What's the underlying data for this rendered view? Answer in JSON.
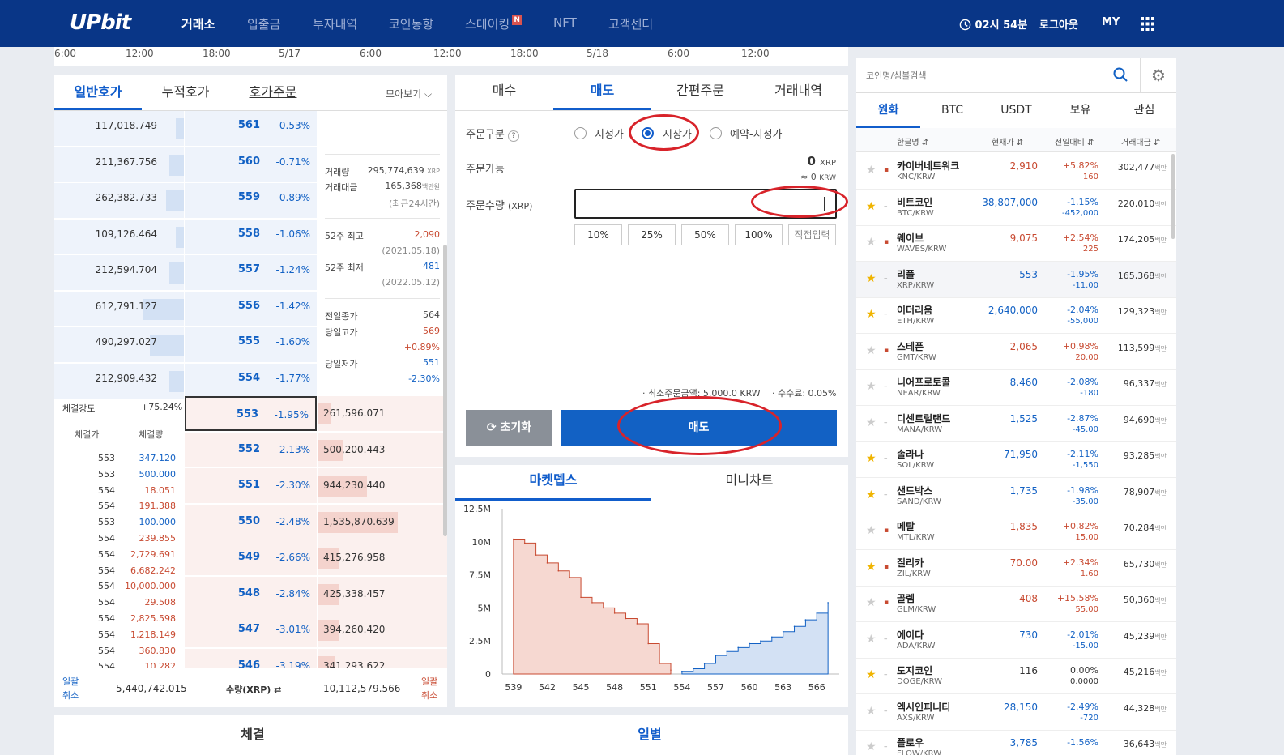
{
  "header": {
    "logo": "UPbit",
    "nav": [
      "거래소",
      "입출금",
      "투자내역",
      "코인동향",
      "스테이킹",
      "NFT",
      "고객센터"
    ],
    "staking_badge": "N",
    "time": "02시 54분",
    "logout": "로그아웃",
    "my": "MY"
  },
  "timeline": {
    "ticks": [
      "6:00",
      "12:00",
      "18:00",
      "5/17",
      "6:00",
      "12:00",
      "18:00",
      "5/18",
      "6:00",
      "12:00"
    ]
  },
  "orderbook": {
    "tabs": [
      "일반호가",
      "누적호가",
      "호가주문"
    ],
    "view": "모아보기",
    "asks": [
      {
        "vol": "117,018.749",
        "price": "561",
        "chg": "-0.53%",
        "bar": 0.06
      },
      {
        "vol": "211,367.756",
        "price": "560",
        "chg": "-0.71%",
        "bar": 0.11
      },
      {
        "vol": "262,382.733",
        "price": "559",
        "chg": "-0.89%",
        "bar": 0.14
      },
      {
        "vol": "109,126.464",
        "price": "558",
        "chg": "-1.06%",
        "bar": 0.06
      },
      {
        "vol": "212,594.704",
        "price": "557",
        "chg": "-1.24%",
        "bar": 0.11
      },
      {
        "vol": "612,791.127",
        "price": "556",
        "chg": "-1.42%",
        "bar": 0.32
      },
      {
        "vol": "490,297.027",
        "price": "555",
        "chg": "-1.60%",
        "bar": 0.26
      },
      {
        "vol": "212,909.432",
        "price": "554",
        "chg": "-1.77%",
        "bar": 0.11
      }
    ],
    "bids": [
      {
        "price": "553",
        "chg": "-1.95%",
        "vol": "261,596.071",
        "bar": 0.14
      },
      {
        "price": "552",
        "chg": "-2.13%",
        "vol": "500,200.443",
        "bar": 0.26
      },
      {
        "price": "551",
        "chg": "-2.30%",
        "vol": "944,230.440",
        "bar": 0.49
      },
      {
        "price": "550",
        "chg": "-2.48%",
        "vol": "1,535,870.639",
        "bar": 0.8
      },
      {
        "price": "549",
        "chg": "-2.66%",
        "vol": "415,276.958",
        "bar": 0.22
      },
      {
        "price": "548",
        "chg": "-2.84%",
        "vol": "425,338.457",
        "bar": 0.22
      },
      {
        "price": "547",
        "chg": "-3.01%",
        "vol": "394,260.420",
        "bar": 0.21
      },
      {
        "price": "546",
        "chg": "-3.19%",
        "vol": "341,293.622",
        "bar": 0.18
      }
    ],
    "stats": {
      "vol_label": "거래량",
      "vol_val": "295,774,639",
      "vol_unit": "XRP",
      "amt_label": "거래대금",
      "amt_val": "165,368",
      "amt_unit": "백만원",
      "period": "(최근24시간)",
      "hi52_label": "52주 최고",
      "hi52": "2,090",
      "hi52_date": "(2021.05.18)",
      "lo52_label": "52주 최저",
      "lo52": "481",
      "lo52_date": "(2022.05.12)",
      "prev_label": "전일종가",
      "prev": "564",
      "high_label": "당일고가",
      "high": "569",
      "high_pct": "+0.89%",
      "low_label": "당일저가",
      "low": "551",
      "low_pct": "-2.30%"
    },
    "strength_label": "체결강도",
    "strength": "+75.24%",
    "trade_hdr": [
      "체결가",
      "체결량"
    ],
    "trades": [
      [
        "553",
        "347.120",
        "b"
      ],
      [
        "553",
        "500.000",
        "b"
      ],
      [
        "554",
        "18.051",
        "r"
      ],
      [
        "554",
        "191.388",
        "r"
      ],
      [
        "553",
        "100.000",
        "b"
      ],
      [
        "554",
        "239.855",
        "r"
      ],
      [
        "554",
        "2,729.691",
        "r"
      ],
      [
        "554",
        "6,682.242",
        "r"
      ],
      [
        "554",
        "10,000.000",
        "r"
      ],
      [
        "554",
        "29.508",
        "r"
      ],
      [
        "554",
        "2,825.598",
        "r"
      ],
      [
        "554",
        "1,218.149",
        "r"
      ],
      [
        "554",
        "360.830",
        "r"
      ],
      [
        "554",
        "10.282",
        "r"
      ]
    ],
    "footer": {
      "cancel_left": "일괄\n취소",
      "total_ask": "5,440,742.015",
      "qty_label": "수량(XRP) ⇄",
      "total_bid": "10,112,579.566",
      "cancel_right": "일괄\n취소"
    }
  },
  "order": {
    "tabs": [
      "매수",
      "매도",
      "간편주문",
      "거래내역"
    ],
    "type_label": "주문구분",
    "opts": [
      "지정가",
      "시장가",
      "예약-지정가"
    ],
    "avail_label": "주문가능",
    "avail_val": "0",
    "avail_unit": "XRP",
    "avail_krw": "≈ 0",
    "avail_krw_unit": "KRW",
    "qty_label": "주문수량",
    "qty_unit": "(XRP)",
    "pcts": [
      "10%",
      "25%",
      "50%",
      "100%",
      "직접입력"
    ],
    "min_order": "· 최소주문금액: 5,000.0 KRW",
    "fee": "· 수수료: 0.05%",
    "reset": "초기화",
    "sell": "매도"
  },
  "depth": {
    "tabs": [
      "마켓뎁스",
      "미니차트"
    ]
  },
  "chart_data": {
    "type": "area",
    "title": "",
    "xlabel": "",
    "ylabel": "",
    "x_ticks": [
      "539",
      "542",
      "545",
      "548",
      "551",
      "554",
      "557",
      "560",
      "563",
      "566"
    ],
    "y_ticks": [
      "0",
      "2.5M",
      "5M",
      "7.5M",
      "10M",
      "12.5M"
    ],
    "ylim": [
      0,
      12.5
    ],
    "series": [
      {
        "color": "#c84a31",
        "x": [
          539,
          540,
          541,
          542,
          543,
          544,
          545,
          546,
          547,
          548,
          549,
          550,
          551,
          552,
          553
        ],
        "y": [
          10.2,
          9.9,
          9.0,
          8.4,
          7.8,
          7.3,
          5.8,
          5.4,
          5.0,
          4.6,
          4.2,
          3.8,
          2.3,
          0.8,
          0.3
        ]
      },
      {
        "color": "#1261c4",
        "x": [
          554,
          555,
          556,
          557,
          558,
          559,
          560,
          561,
          562,
          563,
          564,
          565,
          566,
          567
        ],
        "y": [
          0.2,
          0.4,
          0.8,
          1.4,
          1.7,
          2.0,
          2.3,
          2.5,
          2.8,
          3.2,
          3.6,
          4.1,
          4.6,
          5.4
        ]
      }
    ]
  },
  "bottom": {
    "tabs": [
      "체결",
      "일별"
    ]
  },
  "market": {
    "search_placeholder": "코인명/심볼검색",
    "tabs": [
      "원화",
      "BTC",
      "USDT",
      "보유",
      "관심"
    ],
    "cols": [
      "한글명 ⇵",
      "현재가 ⇵",
      "전일대비 ⇵",
      "거래대금 ⇵"
    ],
    "unit": "백만",
    "rows": [
      {
        "name": "카이버네트워크",
        "sym": "KNC/KRW",
        "price": "2,910",
        "pct": "+5.82%",
        "diff": "160",
        "vol": "302,477",
        "fav": false,
        "up": true
      },
      {
        "name": "비트코인",
        "sym": "BTC/KRW",
        "price": "38,807,000",
        "pct": "-1.15%",
        "diff": "-452,000",
        "vol": "220,010",
        "fav": true,
        "up": false
      },
      {
        "name": "웨이브",
        "sym": "WAVES/KRW",
        "price": "9,075",
        "pct": "+2.54%",
        "diff": "225",
        "vol": "174,205",
        "fav": false,
        "up": true
      },
      {
        "name": "리플",
        "sym": "XRP/KRW",
        "price": "553",
        "pct": "-1.95%",
        "diff": "-11.00",
        "vol": "165,368",
        "fav": true,
        "up": false
      },
      {
        "name": "이더리움",
        "sym": "ETH/KRW",
        "price": "2,640,000",
        "pct": "-2.04%",
        "diff": "-55,000",
        "vol": "129,323",
        "fav": true,
        "up": false
      },
      {
        "name": "스테픈",
        "sym": "GMT/KRW",
        "price": "2,065",
        "pct": "+0.98%",
        "diff": "20.00",
        "vol": "113,599",
        "fav": false,
        "up": true
      },
      {
        "name": "니어프로토콜",
        "sym": "NEAR/KRW",
        "price": "8,460",
        "pct": "-2.08%",
        "diff": "-180",
        "vol": "96,337",
        "fav": false,
        "up": false
      },
      {
        "name": "디센트럴랜드",
        "sym": "MANA/KRW",
        "price": "1,525",
        "pct": "-2.87%",
        "diff": "-45.00",
        "vol": "94,690",
        "fav": false,
        "up": false
      },
      {
        "name": "솔라나",
        "sym": "SOL/KRW",
        "price": "71,950",
        "pct": "-2.11%",
        "diff": "-1,550",
        "vol": "93,285",
        "fav": true,
        "up": false
      },
      {
        "name": "샌드박스",
        "sym": "SAND/KRW",
        "price": "1,735",
        "pct": "-1.98%",
        "diff": "-35.00",
        "vol": "78,907",
        "fav": true,
        "up": false
      },
      {
        "name": "메탈",
        "sym": "MTL/KRW",
        "price": "1,835",
        "pct": "+0.82%",
        "diff": "15.00",
        "vol": "70,284",
        "fav": false,
        "up": true
      },
      {
        "name": "질리카",
        "sym": "ZIL/KRW",
        "price": "70.00",
        "pct": "+2.34%",
        "diff": "1.60",
        "vol": "65,730",
        "fav": true,
        "up": true
      },
      {
        "name": "골렘",
        "sym": "GLM/KRW",
        "price": "408",
        "pct": "+15.58%",
        "diff": "55.00",
        "vol": "50,360",
        "fav": false,
        "up": true
      },
      {
        "name": "에이다",
        "sym": "ADA/KRW",
        "price": "730",
        "pct": "-2.01%",
        "diff": "-15.00",
        "vol": "45,239",
        "fav": false,
        "up": false
      },
      {
        "name": "도지코인",
        "sym": "DOGE/KRW",
        "price": "116",
        "pct": "0.00%",
        "diff": "0.0000",
        "vol": "45,216",
        "fav": true,
        "up": null
      },
      {
        "name": "엑시인피니티",
        "sym": "AXS/KRW",
        "price": "28,150",
        "pct": "-2.49%",
        "diff": "-720",
        "vol": "44,328",
        "fav": false,
        "up": false
      },
      {
        "name": "플로우",
        "sym": "FLOW/KRW",
        "price": "3,785",
        "pct": "-1.56%",
        "diff": "",
        "vol": "36,643",
        "fav": false,
        "up": false
      }
    ]
  }
}
